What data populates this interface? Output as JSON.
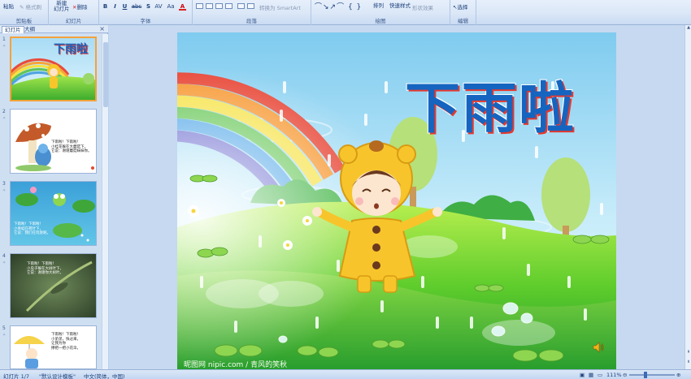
{
  "ribbon": {
    "clipboard": {
      "paste": "粘贴",
      "format_painter": "格式刷",
      "label": "剪贴板"
    },
    "slides": {
      "new_slide_line1": "新建",
      "new_slide_line2": "幻灯片",
      "delete": "删除",
      "label": "幻灯片"
    },
    "font": {
      "bold": "B",
      "italic": "I",
      "underline": "U",
      "strike": "abc",
      "shadow": "S",
      "spacing": "AV",
      "case": "Aa",
      "color": "A",
      "label": "字体"
    },
    "paragraph": {
      "smartart": "转换为 SmartArt",
      "label": "段落"
    },
    "drawing": {
      "arrange": "排列",
      "quick_styles": "快速样式",
      "shape_effects": "形状效果",
      "label": "绘图"
    },
    "editing": {
      "select": "选择",
      "label": "编辑"
    }
  },
  "panel": {
    "tabs": [
      "幻灯片",
      "大纲"
    ],
    "close": "×",
    "slides": [
      {
        "num": "1",
        "title": "下雨啦"
      },
      {
        "num": "2",
        "text": "下雨啦！下雨啦！\n小桂花躲在大蘑菇下，\n它说：谢谢蘑菇妹妹你。"
      },
      {
        "num": "3",
        "text": "下雨啦！下雨啦！\n小青蛙在荷叶下，\n它说：我们在玩耍呢。"
      },
      {
        "num": "4",
        "text": "下雨啦！下雨啦！\n小虫子躲在大树叶下，\n它说：谢谢你大树叶。"
      },
      {
        "num": "5",
        "text": "下雨啦！下雨啦！\n小弟弟，快过来，\n让我为你\n撑把一把小花伞。"
      }
    ]
  },
  "slide": {
    "title": "下雨啦",
    "watermark": "昵图网 nipic.com / 青风的笑秋"
  },
  "status": {
    "slide_info": "幻灯片 1/7",
    "theme": "\"默认设计模板\"",
    "language": "中文(简体，中国)",
    "zoom": "111%"
  },
  "colors": {
    "accent": "#1565c0",
    "title_outline": "#e5392f",
    "selection": "#f4a23b"
  }
}
